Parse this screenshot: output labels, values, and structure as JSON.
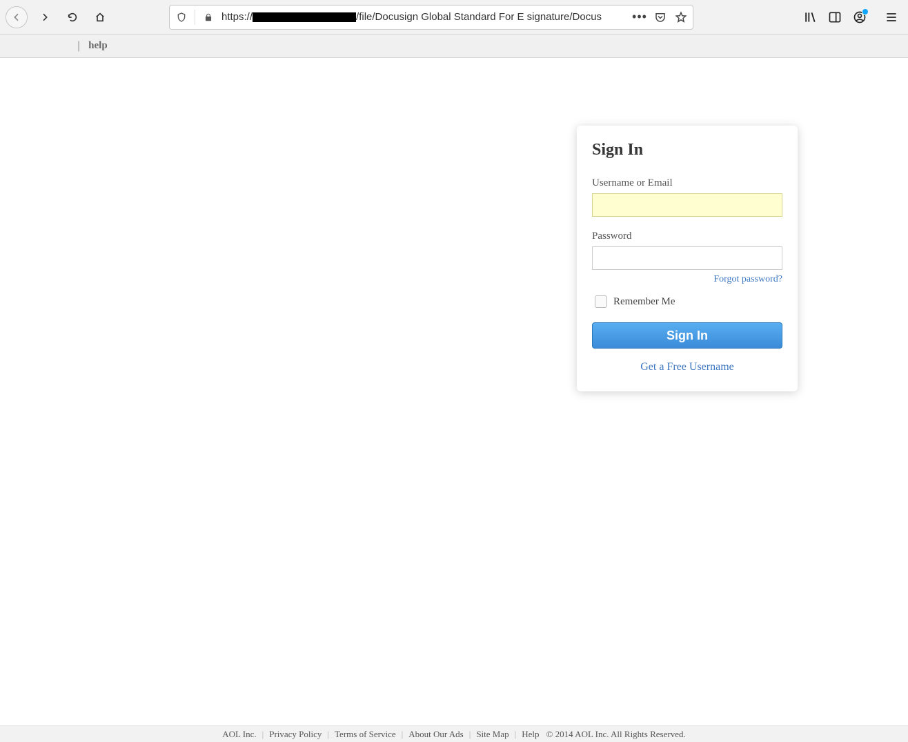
{
  "browser": {
    "url_prefix": "https://",
    "url_suffix": "/file/Docusign Global Standard For E signature/Docus"
  },
  "subbar": {
    "help": "help"
  },
  "signin": {
    "heading": "Sign In",
    "username_label": "Username or Email",
    "password_label": "Password",
    "forgot": "Forgot password?",
    "remember": "Remember Me",
    "submit": "Sign In",
    "free_user": "Get a Free Username"
  },
  "footer": {
    "company": "AOL Inc.",
    "privacy": "Privacy Policy",
    "terms": "Terms of Service",
    "ads": "About Our Ads",
    "sitemap": "Site Map",
    "help": "Help",
    "copyright": "© 2014 AOL Inc. All Rights Reserved."
  }
}
